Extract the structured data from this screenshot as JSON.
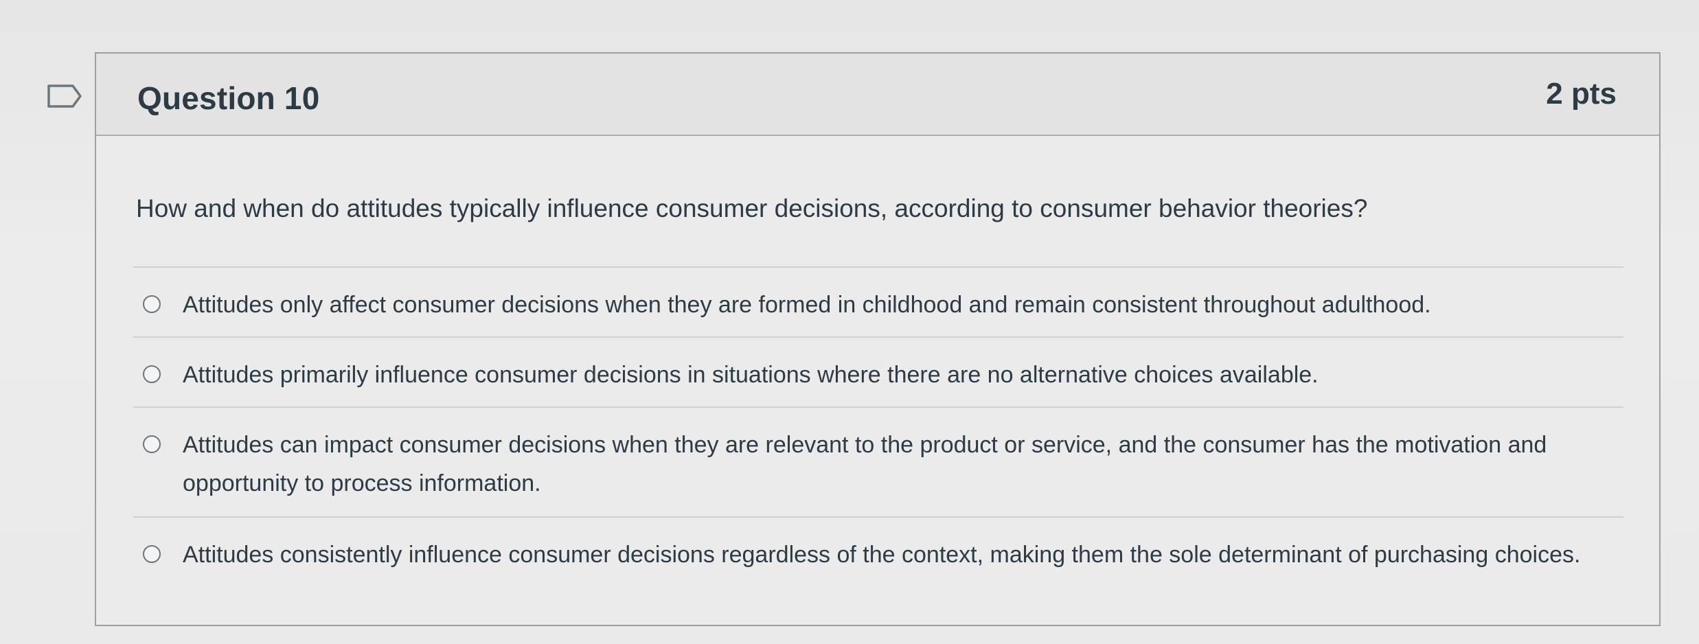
{
  "question": {
    "title": "Question 10",
    "points": "2 pts",
    "text": "How and when do attitudes typically influence consumer decisions, according to consumer behavior theories?"
  },
  "answers": [
    {
      "label": "Attitudes only affect consumer decisions when they are formed in childhood and remain consistent throughout adulthood."
    },
    {
      "label": "Attitudes primarily influence consumer decisions in situations where there are no alternative choices available."
    },
    {
      "label": "Attitudes can impact consumer decisions when they are relevant to the product or service, and the consumer has the motivation and opportunity to process information."
    },
    {
      "label": "Attitudes consistently influence consumer decisions regardless of the context, making them the sole determinant of purchasing choices."
    }
  ],
  "icons": {
    "bookmark": "bookmark-flag-icon",
    "radio": "radio-button-unselected"
  },
  "colors": {
    "text": "#2d3b45",
    "border": "#9aa0a4",
    "header_bg": "#e3e3e3"
  }
}
